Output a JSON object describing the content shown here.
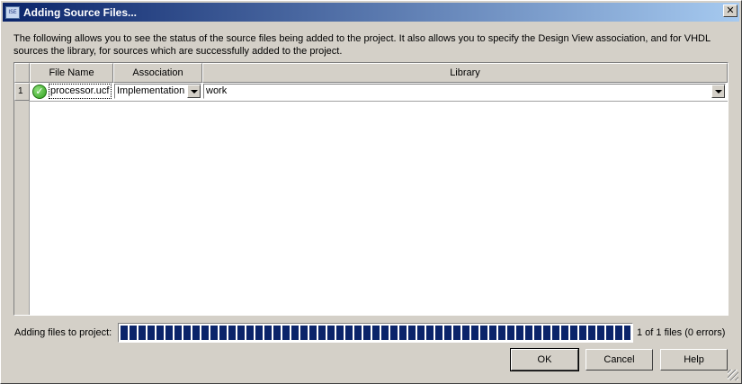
{
  "window": {
    "title": "Adding Source Files...",
    "close_glyph": "✕",
    "app_icon": "ise-app-icon"
  },
  "description": "The following allows you to see the status of the source files being added to the project.  It also allows you to specify the Design View association, and for VHDL sources the library, for sources which are successfully added to the project.",
  "table": {
    "columns": [
      "File Name",
      "Association",
      "Library"
    ],
    "rows": [
      {
        "index": "1",
        "status_icon": "check-icon",
        "file_name": "processor.ucf",
        "association": "Implementation",
        "library": "work"
      }
    ]
  },
  "progress": {
    "label": "Adding files to project:",
    "fraction": 1.0,
    "text": "1 of 1 files (0 errors)"
  },
  "buttons": {
    "ok": "OK",
    "cancel": "Cancel",
    "help": "Help"
  },
  "colors": {
    "title_gradient_start": "#0a246a",
    "title_gradient_end": "#a6caf0",
    "progress_fill": "#0a246a",
    "status_green": "#2e9e1e"
  }
}
